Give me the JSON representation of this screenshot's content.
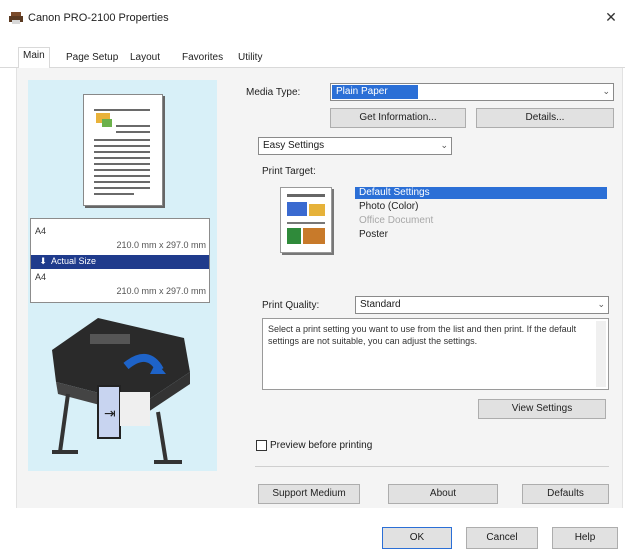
{
  "window": {
    "title": "Canon PRO-2100 Properties"
  },
  "tabs": [
    "Main",
    "Page Setup",
    "Layout",
    "Favorites",
    "Utility"
  ],
  "preview": {
    "paper_sizes": [
      {
        "label": "A4",
        "dim": "210.0 mm x 297.0 mm"
      },
      {
        "label": "Actual Size",
        "dim": ""
      },
      {
        "label": "A4",
        "dim": "210.0 mm x 297.0 mm"
      }
    ]
  },
  "main": {
    "media_type_label": "Media Type:",
    "media_type_value": "Plain Paper",
    "get_information_label": "Get Information...",
    "media_details_label": "Details...",
    "easy_settings_value": "Easy Settings",
    "print_target_label": "Print Target:",
    "print_targets": [
      {
        "label": "Default Settings",
        "state": "selected"
      },
      {
        "label": "Photo (Color)",
        "state": "normal"
      },
      {
        "label": "Office Document",
        "state": "disabled"
      },
      {
        "label": "Poster",
        "state": "normal"
      }
    ],
    "print_quality_label": "Print Quality:",
    "print_quality_value": "Standard",
    "description": "Select a print setting you want to use from the list and then print. If the default settings are not suitable, you can adjust the settings.",
    "view_settings_label": "View Settings",
    "preview_before_printing_label": "Preview before printing",
    "support_label": "Support Medium",
    "about_label": "About",
    "defaults_label": "Defaults"
  },
  "footer": {
    "ok_label": "OK",
    "cancel_label": "Cancel",
    "help_label": "Help"
  },
  "colors": {
    "accent": "#2b6fd6",
    "selection": "#1f3b8c",
    "preview_bg": "#d8f0f8"
  }
}
